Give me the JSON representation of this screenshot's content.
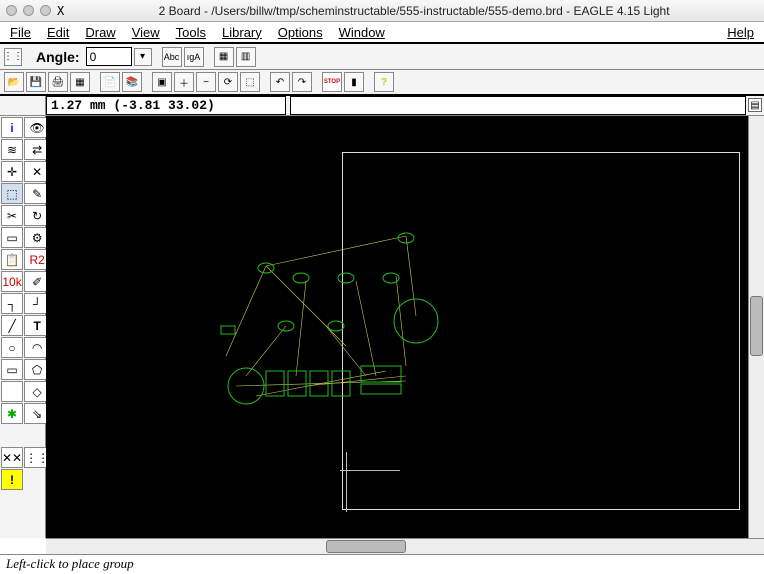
{
  "window": {
    "title": "2 Board - /Users/billw/tmp/scheminstructable/555-instructable/555-demo.brd - EAGLE 4.15 Light"
  },
  "menu": {
    "file": "File",
    "edit": "Edit",
    "draw": "Draw",
    "view": "View",
    "tools": "Tools",
    "library": "Library",
    "options": "Options",
    "window": "Window",
    "help": "Help"
  },
  "angle": {
    "label": "Angle:",
    "value": "0"
  },
  "coord": {
    "text": "1.27 mm (-3.81 33.02)"
  },
  "command": {
    "value": ""
  },
  "status": {
    "text": "Left-click to place group"
  },
  "icons": {
    "open": "📂",
    "save": "💾",
    "print": "🖨",
    "cam": "▦",
    "script": "📄",
    "ulp": "📚",
    "zoomfit": "▣",
    "zoomin": "＋",
    "zoomout": "−",
    "zoomredraw": "⟳",
    "zoomsel": "⬚",
    "undo": "↶",
    "redo": "↷",
    "stop": "STOP",
    "go": "▮",
    "help": "?",
    "abc": "Abc",
    "iga": "ıgA",
    "grid1": "▦",
    "grid2": "▥",
    "dot": "⋮⋮"
  },
  "tools": {
    "info": "i",
    "eye": "👁",
    "layers": "≋",
    "mirror": "⇄",
    "crosshair": "✛",
    "man": "✕",
    "marquee": "⬚",
    "move": "✎",
    "copy": "✂",
    "rotate": "↻",
    "group": "▭",
    "smash": "⚙",
    "paste": "📋",
    "r2": "R2",
    "r3": "10k",
    "name": "✐",
    "value": "✐",
    "split": "┐",
    "miter": "┘",
    "line": "╱",
    "text": "T",
    "circle": "○",
    "arc": "◠",
    "rect": "▭",
    "poly": "⬠",
    "filled": "●",
    "unfilled": "◇",
    "via": "✱",
    "signal": "⇘",
    "ratsnest": "✕✕",
    "drc2": "⋮⋮",
    "err": "!"
  }
}
